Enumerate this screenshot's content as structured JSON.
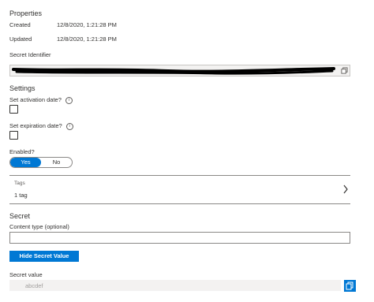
{
  "properties": {
    "heading": "Properties",
    "created_label": "Created",
    "created_value": "12/8/2020, 1:21:28 PM",
    "updated_label": "Updated",
    "updated_value": "12/8/2020, 1:21:28 PM",
    "identifier_label": "Secret Identifier"
  },
  "settings": {
    "heading": "Settings",
    "activation_label": "Set activation date?",
    "expiration_label": "Set expiration date?",
    "enabled_label": "Enabled?",
    "toggle_yes": "Yes",
    "toggle_no": "No"
  },
  "tags": {
    "label": "Tags",
    "value": "1 tag"
  },
  "secret": {
    "heading": "Secret",
    "content_type_label": "Content type (optional)",
    "content_type_value": "",
    "hide_button_label": "Hide Secret Value",
    "secret_value_label": "Secret value",
    "secret_value": "abcdef"
  },
  "colors": {
    "accent": "#0078d4",
    "redaction": "#000000"
  },
  "icons": {
    "info": "info-icon",
    "copy": "copy-icon",
    "chevron": "chevron-right-icon"
  }
}
